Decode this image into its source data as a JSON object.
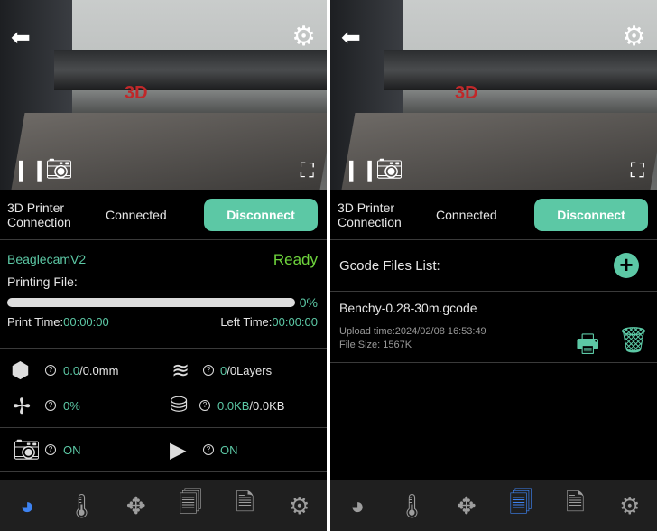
{
  "colors": {
    "accent": "#5cc8a5",
    "ready": "#6ed43c",
    "active_nav": "#3d82f0",
    "nav_bg": "#1f1f1f"
  },
  "camera": {
    "sign_text": "3D"
  },
  "connection": {
    "label": "3D Printer Connection",
    "status": "Connected",
    "button": "Disconnect"
  },
  "status": {
    "device": "BeaglecamV2",
    "state": "Ready",
    "printing_file_label": "Printing File:",
    "progress_percent": 0,
    "progress_text": "0%",
    "print_time_label": "Print Time:",
    "print_time": "00:00:00",
    "left_time_label": "Left Time:",
    "left_time": "00:00:00"
  },
  "stats": {
    "height_cur": "0.0",
    "height_total": "/0.0mm",
    "layers_cur": "0",
    "layers_total": "/0Layers",
    "fan": "0%",
    "data_cur": "0.0KB",
    "data_total": "/0.0KB",
    "camera": "ON",
    "video": "ON"
  },
  "files": {
    "title": "Gcode Files List:",
    "items": [
      {
        "name": "Benchy-0.28-30m.gcode",
        "upload": "Upload time:2024/02/08 16:53:49",
        "size": "File Size: 1567K"
      }
    ]
  },
  "nav": [
    "dashboard-icon",
    "thermometer-icon",
    "move-icon",
    "files-icon",
    "video-file-icon",
    "settings-icon"
  ]
}
